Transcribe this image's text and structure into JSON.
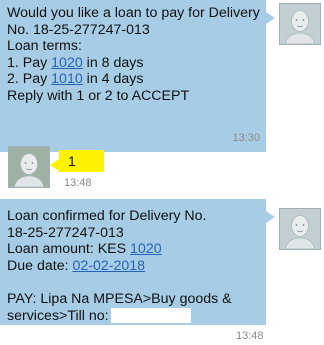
{
  "colors": {
    "incoming_bubble": "#a7cde6",
    "outgoing_bubble": "#fff200",
    "link": "#2563b8",
    "timestamp": "#8a8a8a"
  },
  "messages": [
    {
      "direction": "incoming",
      "line1": "Would you like a loan to pay for Delivery",
      "line2": "No. 18-25-277247-013",
      "line3": "Loan terms:",
      "line4_prefix": "1. Pay ",
      "line4_amount": "1020",
      "line4_suffix": " in 8 days",
      "line5_prefix": "2. Pay ",
      "line5_amount": "1010",
      "line5_suffix": " in 4 days",
      "line6": "Reply with 1 or 2 to ACCEPT",
      "time": "13:30"
    },
    {
      "direction": "outgoing",
      "text": "1",
      "time": "13:48"
    },
    {
      "direction": "incoming",
      "line1": "Loan confirmed for Delivery No.",
      "line2": "18-25-277247-013",
      "line3_prefix": "Loan amount: KES ",
      "line3_amount": "1020",
      "line4_prefix": "Due date: ",
      "line4_date": "02-02-2018",
      "line5": "PAY: Lipa Na MPESA>Buy goods &",
      "line6_prefix": "services>Till no:",
      "time": "13:48"
    }
  ],
  "icons": {
    "contact_avatar": "person-avatar-icon",
    "user_avatar": "person-avatar-icon"
  }
}
